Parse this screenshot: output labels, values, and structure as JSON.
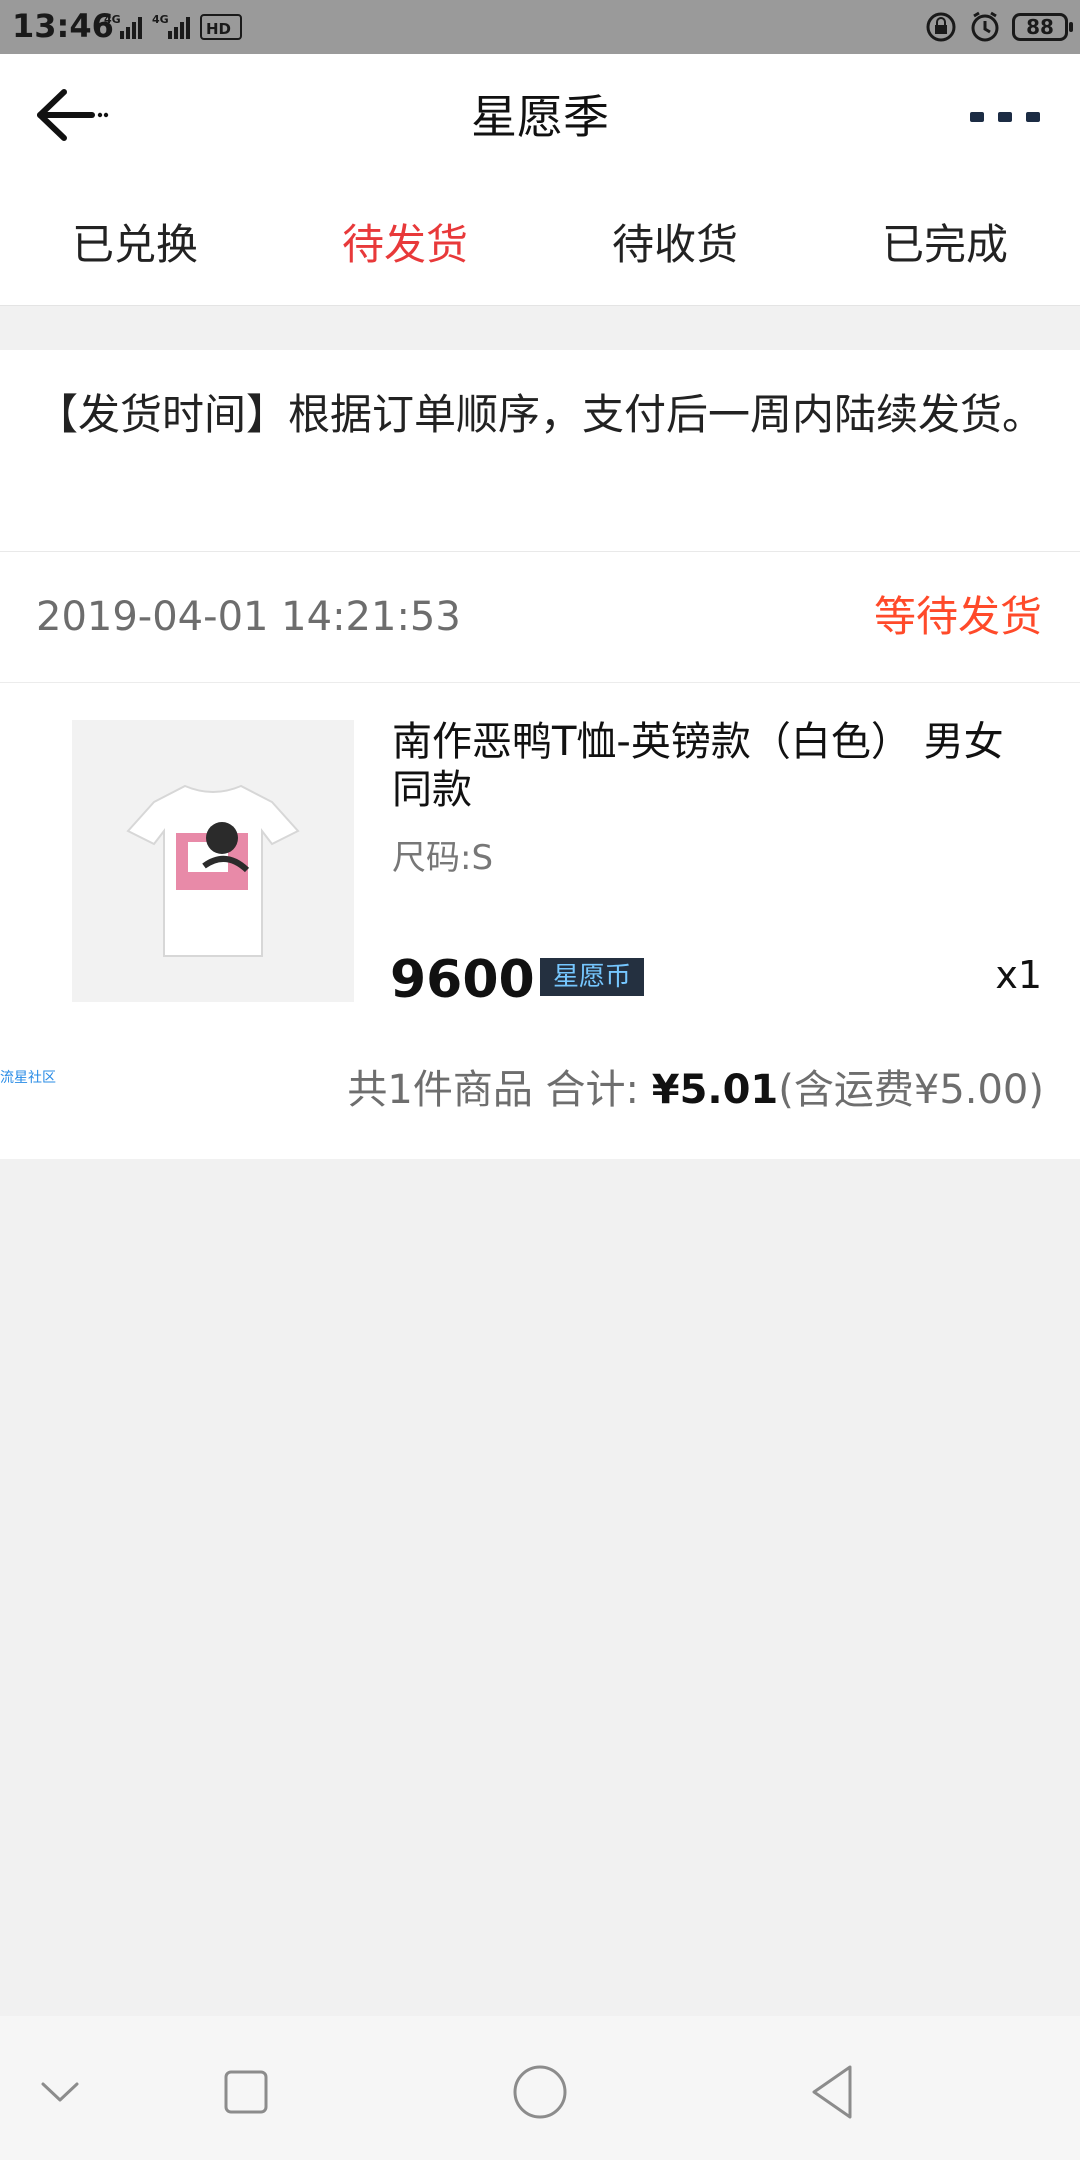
{
  "status_bar": {
    "time": "13:46",
    "network_1": "4G",
    "network_2": "4G",
    "hd_label": "HD",
    "battery": "88"
  },
  "header": {
    "title": "星愿季"
  },
  "tabs": [
    {
      "label": "已兑换",
      "active": false
    },
    {
      "label": "待发货",
      "active": true
    },
    {
      "label": "待收货",
      "active": false
    },
    {
      "label": "已完成",
      "active": false
    }
  ],
  "notice": {
    "text": "【发货时间】根据订单顺序，支付后一周内陆续发货。"
  },
  "order": {
    "time": "2019-04-01 14:21:53",
    "status": "等待发货",
    "product": {
      "name": "南作恶鸭T恤-英镑款（白色） 男女同款",
      "size": "尺码:S",
      "price": "9600",
      "currency_badge": "星愿币",
      "quantity": "x1"
    },
    "summary": {
      "count_text": "共1件商品 合计: ",
      "amount": "¥5.01",
      "shipping": "(含运费¥5.00)"
    },
    "watermark": "流星社区"
  },
  "colors": {
    "accent_red": "#e8393a",
    "status_orange_red": "#ff4a2a",
    "badge_bg": "#243040",
    "badge_text": "#76c7ff"
  },
  "icons": {
    "back": "arrow-left-icon",
    "more": "more-dots-icon",
    "nav_down": "chevron-down-icon",
    "nav_square": "square-icon",
    "nav_circle": "circle-icon",
    "nav_back": "triangle-back-icon"
  }
}
